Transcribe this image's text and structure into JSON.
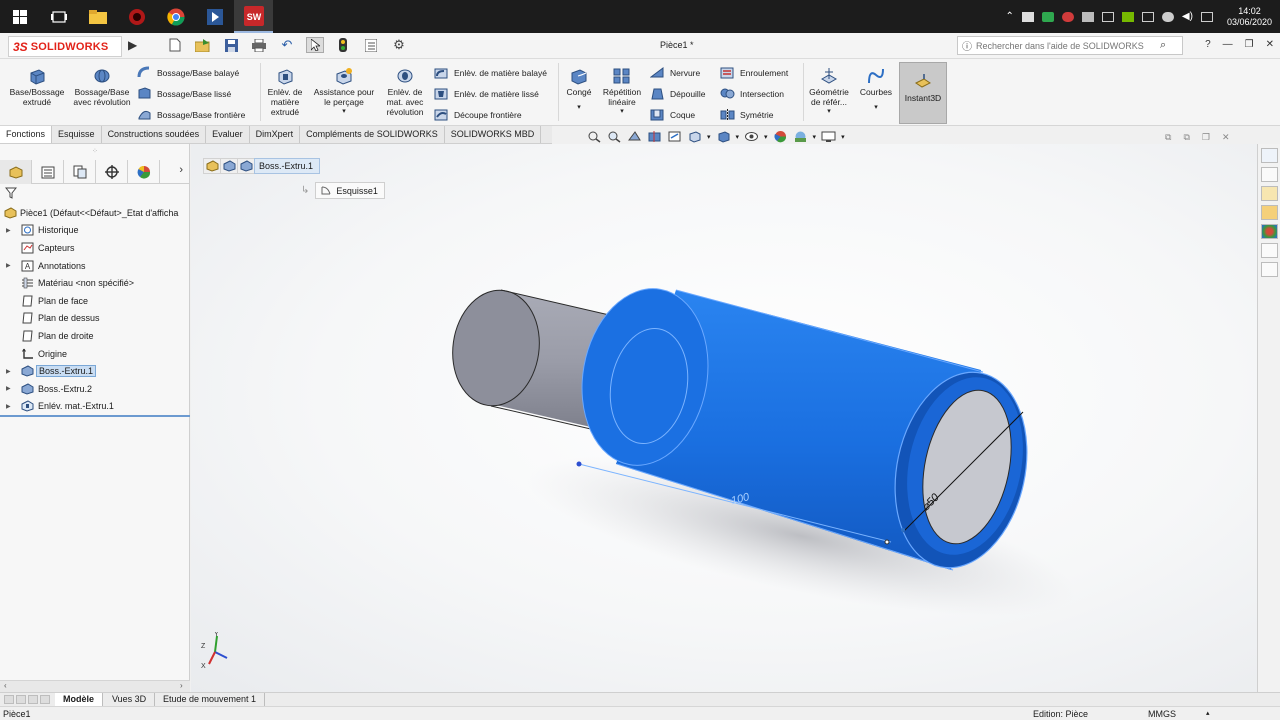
{
  "taskbar": {
    "clock_time": "14:02",
    "clock_date": "03/06/2020"
  },
  "app": {
    "logo_ds": "3S",
    "logo_name": "SOLIDWORKS",
    "document_title": "Pièce1 *",
    "help_search_placeholder": "Rechercher dans l'aide de SOLIDWORKS",
    "help_label": "?"
  },
  "ribbon": {
    "extrude_boss": "Base/Bossage extrudé",
    "revolve_boss": "Bossage/Base avec révolution",
    "swept_boss": "Bossage/Base balayé",
    "lofted_boss": "Bossage/Base lissé",
    "boundary_boss": "Bossage/Base frontière",
    "extruded_cut": "Enlèv. de matière extrudé",
    "hole_wizard": "Assistance pour le perçage",
    "revolved_cut": "Enlèv. de mat. avec révolution",
    "swept_cut": "Enlèv. de matière balayé",
    "lofted_cut": "Enlèv. de matière lissé",
    "boundary_cut": "Découpe frontière",
    "fillet": "Congé",
    "linear_pattern": "Répétition linéaire",
    "rib": "Nervure",
    "draft": "Dépouille",
    "shell": "Coque",
    "wrap": "Enroulement",
    "intersect": "Intersection",
    "mirror": "Symétrie",
    "ref_geometry": "Géométrie de référ...",
    "curves": "Courbes",
    "instant3d": "Instant3D"
  },
  "cm_tabs": [
    "Fonctions",
    "Esquisse",
    "Constructions soudées",
    "Evaluer",
    "DimXpert",
    "Compléments de SOLIDWORKS",
    "SOLIDWORKS MBD"
  ],
  "tree": {
    "root": "Pièce1  (Défaut<<Défaut>_Etat d'afficha",
    "items": [
      {
        "label": "Historique",
        "icon": "history-icon",
        "expandable": true
      },
      {
        "label": "Capteurs",
        "icon": "sensor-icon",
        "expandable": false
      },
      {
        "label": "Annotations",
        "icon": "annotation-icon",
        "expandable": true
      },
      {
        "label": "Matériau <non spécifié>",
        "icon": "material-icon",
        "expandable": false
      },
      {
        "label": "Plan de face",
        "icon": "plane-icon",
        "expandable": false
      },
      {
        "label": "Plan de dessus",
        "icon": "plane-icon",
        "expandable": false
      },
      {
        "label": "Plan de droite",
        "icon": "plane-icon",
        "expandable": false
      },
      {
        "label": "Origine",
        "icon": "origin-icon",
        "expandable": false
      },
      {
        "label": "Boss.-Extru.1",
        "icon": "extrude-feature-icon",
        "expandable": true,
        "selected": true
      },
      {
        "label": "Boss.-Extru.2",
        "icon": "extrude-feature-icon",
        "expandable": true
      },
      {
        "label": "Enlév. mat.-Extru.1",
        "icon": "cut-feature-icon",
        "expandable": true
      }
    ]
  },
  "breadcrumb": {
    "feature": "Boss.-Extru.1",
    "sketch": "Esquisse1"
  },
  "model": {
    "length_dim": "100",
    "diameter_dim": "⌀50",
    "body_color": "#1a6fe0",
    "shaft_color": "#9a9ca8"
  },
  "triad": {
    "y": "Y",
    "z": "Z",
    "x": "X"
  },
  "bottom_tabs": [
    "Modèle",
    "Vues 3D",
    "Etude de mouvement 1"
  ],
  "status": {
    "left": "Pièce1",
    "mode": "Edition: Pièce",
    "units": "MMGS"
  }
}
